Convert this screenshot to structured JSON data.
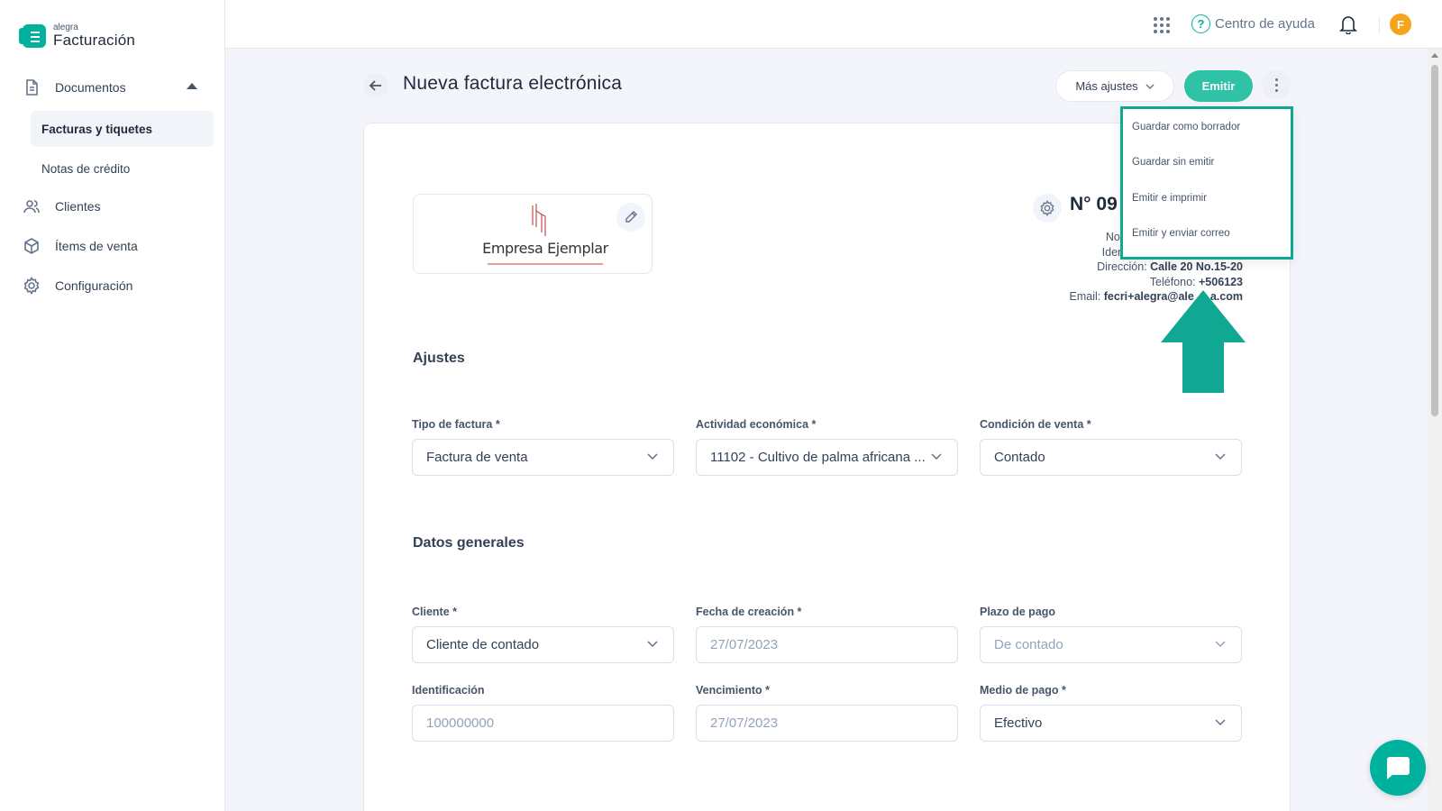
{
  "brand": {
    "small": "alegra",
    "name": "Facturación"
  },
  "sidebar": {
    "documents": "Documentos",
    "invoices": "Facturas y tiquetes",
    "credit_notes": "Notas de crédito",
    "clients": "Clientes",
    "items": "Ítems de venta",
    "settings": "Configuración"
  },
  "topbar": {
    "help": "Centro de ayuda",
    "avatar": "F"
  },
  "header": {
    "title": "Nueva factura electrónica",
    "more_settings": "Más ajustes",
    "emit": "Emitir"
  },
  "menu": {
    "items": [
      "Guardar como borrador",
      "Guardar sin emitir",
      "Emitir e imprimir",
      "Emitir y enviar correo"
    ]
  },
  "company": {
    "logo_text": "Empresa Ejemplar",
    "number": "N° 09",
    "name_label": "Nor",
    "id_label": "Iden",
    "address_label": "Dirección:",
    "address": "Calle 20 No.15-20",
    "phone_label": "Teléfono:",
    "phone": "+506123",
    "email_label": "Email:",
    "email": "fecri+alegra@ale",
    "email_tail": "a.com"
  },
  "settings_section": {
    "title": "Ajustes",
    "invoice_type_label": "Tipo de factura *",
    "invoice_type": "Factura de venta",
    "activity_label": "Actividad económica *",
    "activity": "11102 - Cultivo de palma africana ...",
    "sale_condition_label": "Condición de venta *",
    "sale_condition": "Contado"
  },
  "general_section": {
    "title": "Datos generales",
    "client_label": "Cliente *",
    "client": "Cliente de contado",
    "created_label": "Fecha de creación *",
    "created": "27/07/2023",
    "term_label": "Plazo de pago",
    "term": "De contado",
    "id_label": "Identificación",
    "id_value": "100000000",
    "due_label": "Vencimiento *",
    "due": "27/07/2023",
    "payment_label": "Medio de pago *",
    "payment": "Efectivo"
  },
  "colors": {
    "accent": "#30c2a6",
    "highlight": "#10a892",
    "avatar": "#f7a41d"
  }
}
